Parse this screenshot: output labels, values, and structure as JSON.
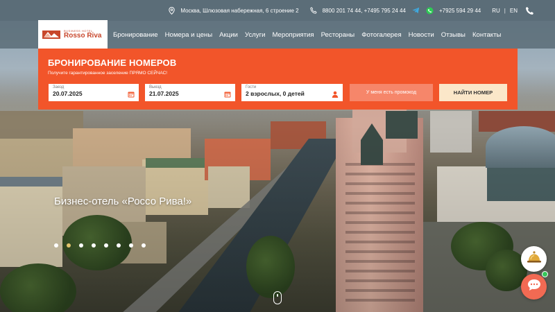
{
  "topbar": {
    "address": "Москва, Шлюзовая набережная, 6 строение 2",
    "phones": "8800 201 74 44, +7495 795 24 44",
    "mobile": "+7925 594 29 44",
    "lang_ru": "RU",
    "lang_sep": "|",
    "lang_en": "EN",
    "icons": [
      "location-pin-icon",
      "phone-icon",
      "telegram-icon",
      "whatsapp-icon",
      "phone-handset-icon"
    ]
  },
  "logo": {
    "tagline": "BUSINESS HOTEL",
    "name": "Rosso Riva"
  },
  "nav": {
    "items": [
      "Бронирование",
      "Номера и цены",
      "Акции",
      "Услуги",
      "Мероприятия",
      "Рестораны",
      "Фотогалерея",
      "Новости",
      "Отзывы",
      "Контакты"
    ]
  },
  "booking": {
    "title": "БРОНИРОВАНИЕ НОМЕРОВ",
    "subtitle": "Получите гарантированное заселение ПРЯМО СЕЙЧАС!",
    "checkin_label": "Заезд",
    "checkin_value": "20.07.2025",
    "checkout_label": "Выезд",
    "checkout_value": "21.07.2025",
    "guests_label": "Гости",
    "guests_value": "2 взрослых, 0 детей",
    "promo_label": "У меня есть промокод",
    "find_label": "НАЙТИ НОМЕР"
  },
  "slider": {
    "title": "Бизнес-отель «Россо Рива!»",
    "dot_count": 8,
    "active_dot": 1
  },
  "colors": {
    "accent": "#f2552a",
    "topbar": "#5b6d78",
    "find_button": "#fbe7c9",
    "active_dot": "#e2c46c",
    "chat": "#f26a53"
  }
}
